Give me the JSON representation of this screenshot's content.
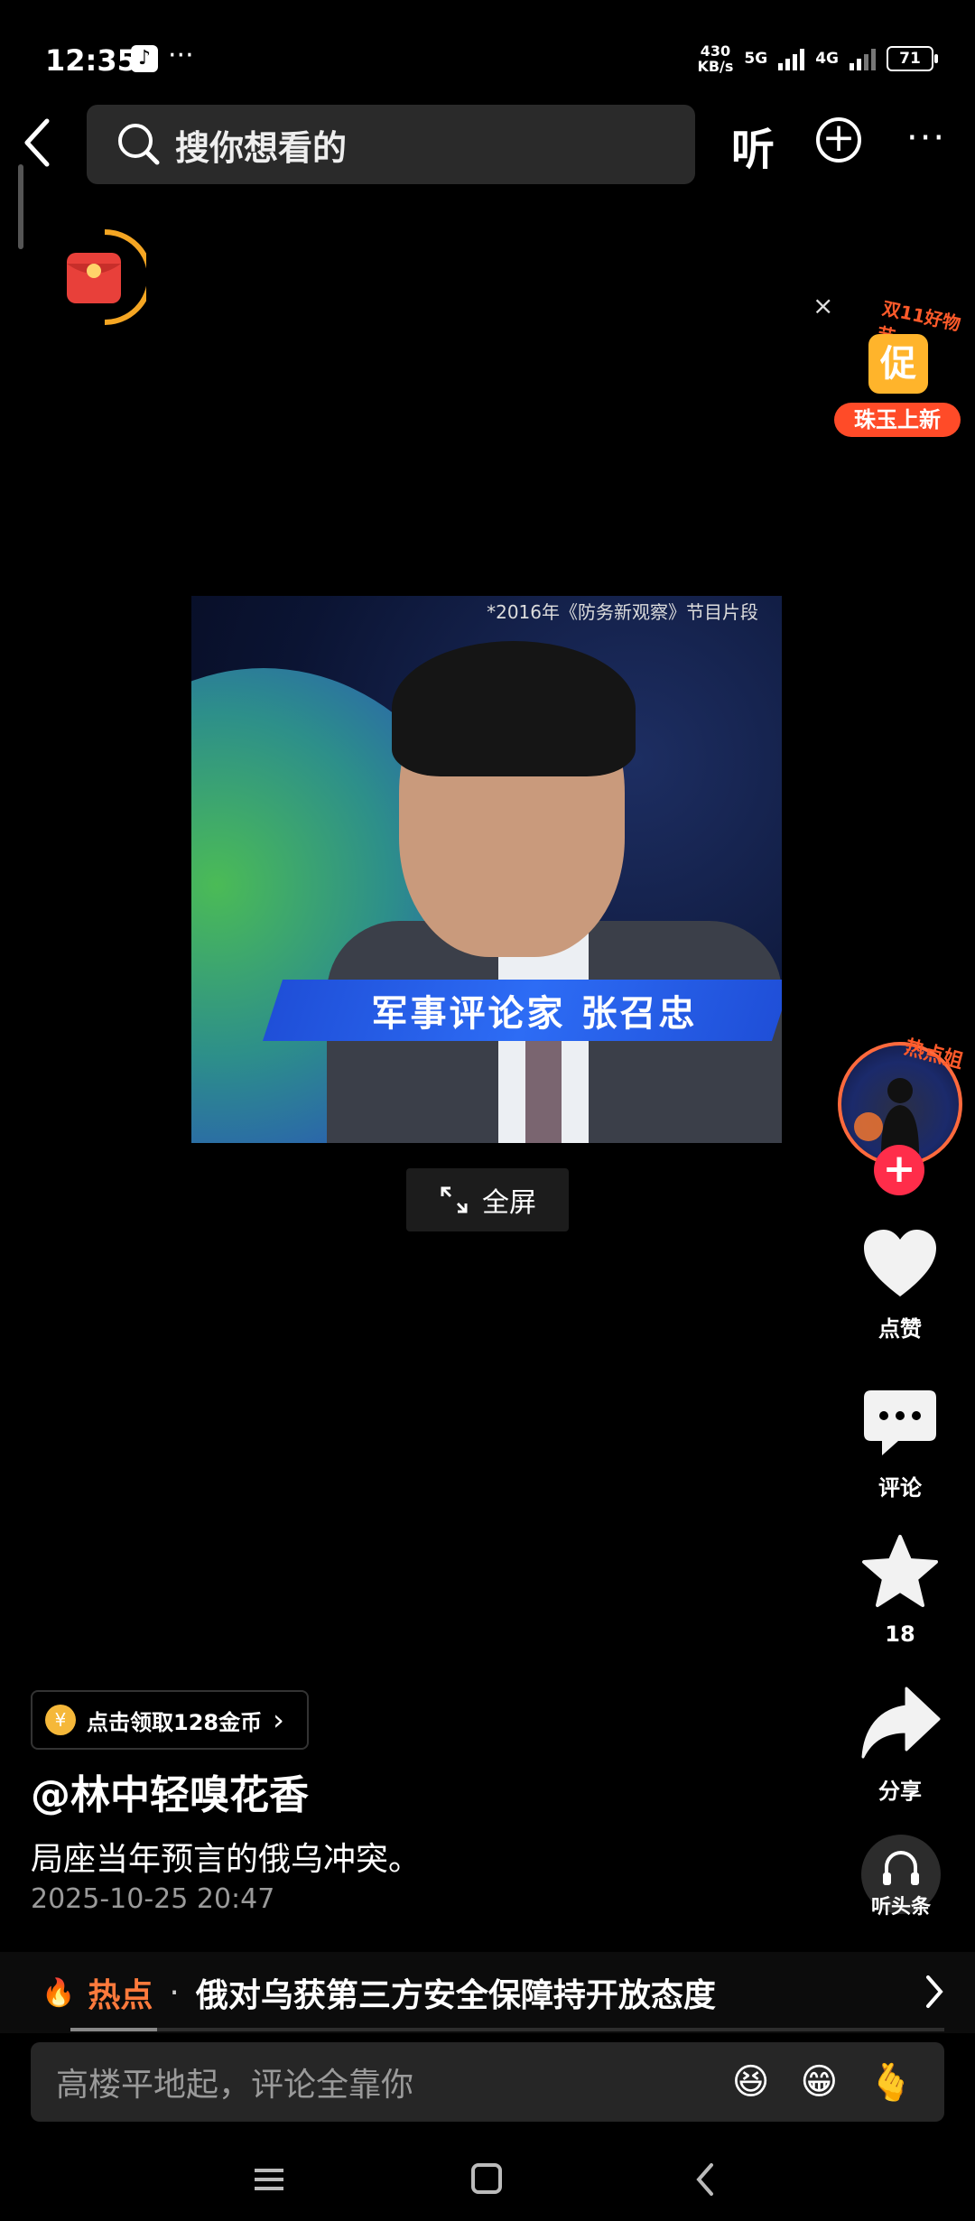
{
  "status_bar": {
    "time": "12:35",
    "app_icon": "tiktok-icon",
    "overflow": "···",
    "net_speed_value": "430",
    "net_speed_unit": "KB/s",
    "network_1": "5G",
    "network_2": "4G",
    "battery": "71"
  },
  "top_nav": {
    "search_placeholder": "搜你想看的",
    "listen_label": "听",
    "more_label": "···"
  },
  "promo": {
    "top_text": "双11好物节",
    "badge_text": "促",
    "label": "珠玉上新",
    "close": "×"
  },
  "video": {
    "top_caption": "*2016年《防务新观察》节目片段",
    "lower_third": "军事评论家 张召忠",
    "fullscreen_label": "全屏"
  },
  "rail": {
    "avatar_tag": "热点姐",
    "follow": "+",
    "like_label": "点赞",
    "comment_label": "评论",
    "favorite_count": "18",
    "share_label": "分享",
    "listen_news_label": "听头条"
  },
  "post": {
    "coin_icon": "¥",
    "coin_text": "点击领取128金币",
    "coin_chevron": "›",
    "author": "@林中轻嗅花香",
    "description": "局座当年预言的俄乌冲突。",
    "date": "2025-10-25 20:47"
  },
  "hot": {
    "flame": "🔥",
    "label": "热点",
    "dot": "·",
    "headline": "俄对乌获第三方安全保障持开放态度"
  },
  "comment": {
    "placeholder": "高楼平地起，评论全靠你",
    "emojis": [
      "😆",
      "😁",
      "🫰"
    ]
  },
  "colors": {
    "accent": "#ff5a2a",
    "follow": "#ff2d4a",
    "background": "#000000"
  }
}
